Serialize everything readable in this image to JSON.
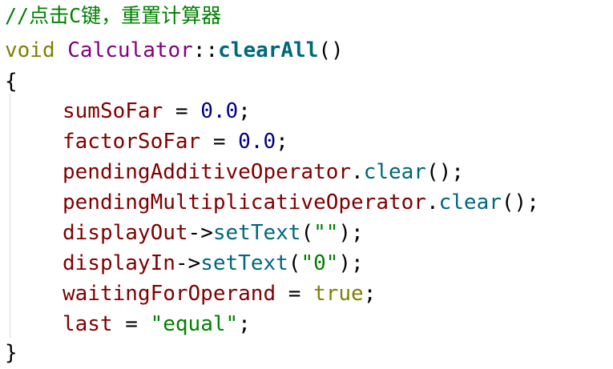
{
  "editor": {
    "lines": [
      {
        "tokens": [
          {
            "text": "//点击C键，重置计算器",
            "color": "#008000"
          }
        ]
      },
      {
        "tokens": [
          {
            "text": "void",
            "color": "#808000"
          },
          {
            "text": " ",
            "color": "#000000"
          },
          {
            "text": "Calculator",
            "color": "#800080"
          },
          {
            "text": "::",
            "color": "#000000"
          },
          {
            "text": "clearAll",
            "color": "#00677c",
            "bold": true
          },
          {
            "text": "()",
            "color": "#000000"
          }
        ]
      },
      {
        "tokens": [
          {
            "text": "{",
            "color": "#000000"
          }
        ]
      },
      {
        "tokens": [
          {
            "text": "sumSoFar",
            "color": "#800000"
          },
          {
            "text": " = ",
            "color": "#000000"
          },
          {
            "text": "0.0",
            "color": "#000080"
          },
          {
            "text": ";",
            "color": "#000000"
          }
        ]
      },
      {
        "tokens": [
          {
            "text": "factorSoFar",
            "color": "#800000"
          },
          {
            "text": " = ",
            "color": "#000000"
          },
          {
            "text": "0.0",
            "color": "#000080"
          },
          {
            "text": ";",
            "color": "#000000"
          }
        ]
      },
      {
        "tokens": [
          {
            "text": "pendingAdditiveOperator",
            "color": "#800000"
          },
          {
            "text": ".",
            "color": "#000000"
          },
          {
            "text": "clear",
            "color": "#00677c"
          },
          {
            "text": "();",
            "color": "#000000"
          }
        ]
      },
      {
        "tokens": [
          {
            "text": "pendingMultiplicativeOperator",
            "color": "#800000"
          },
          {
            "text": ".",
            "color": "#000000"
          },
          {
            "text": "clear",
            "color": "#00677c"
          },
          {
            "text": "();",
            "color": "#000000"
          }
        ]
      },
      {
        "tokens": [
          {
            "text": "displayOut",
            "color": "#800000"
          },
          {
            "text": "->",
            "color": "#000000"
          },
          {
            "text": "setText",
            "color": "#00677c"
          },
          {
            "text": "(",
            "color": "#000000"
          },
          {
            "text": "\"\"",
            "color": "#008000"
          },
          {
            "text": ");",
            "color": "#000000"
          }
        ]
      },
      {
        "tokens": [
          {
            "text": "displayIn",
            "color": "#800000"
          },
          {
            "text": "->",
            "color": "#000000"
          },
          {
            "text": "setText",
            "color": "#00677c"
          },
          {
            "text": "(",
            "color": "#000000"
          },
          {
            "text": "\"0\"",
            "color": "#008000"
          },
          {
            "text": ");",
            "color": "#000000"
          }
        ]
      },
      {
        "tokens": [
          {
            "text": "waitingForOperand",
            "color": "#800000"
          },
          {
            "text": " = ",
            "color": "#000000"
          },
          {
            "text": "true",
            "color": "#808000"
          },
          {
            "text": ";",
            "color": "#000000"
          }
        ]
      },
      {
        "tokens": [
          {
            "text": "last",
            "color": "#800000"
          },
          {
            "text": " = ",
            "color": "#000000"
          },
          {
            "text": "\"equal\"",
            "color": "#008000"
          },
          {
            "text": ";",
            "color": "#000000"
          }
        ]
      },
      {
        "tokens": [
          {
            "text": "}",
            "color": "#000000"
          }
        ]
      }
    ]
  }
}
